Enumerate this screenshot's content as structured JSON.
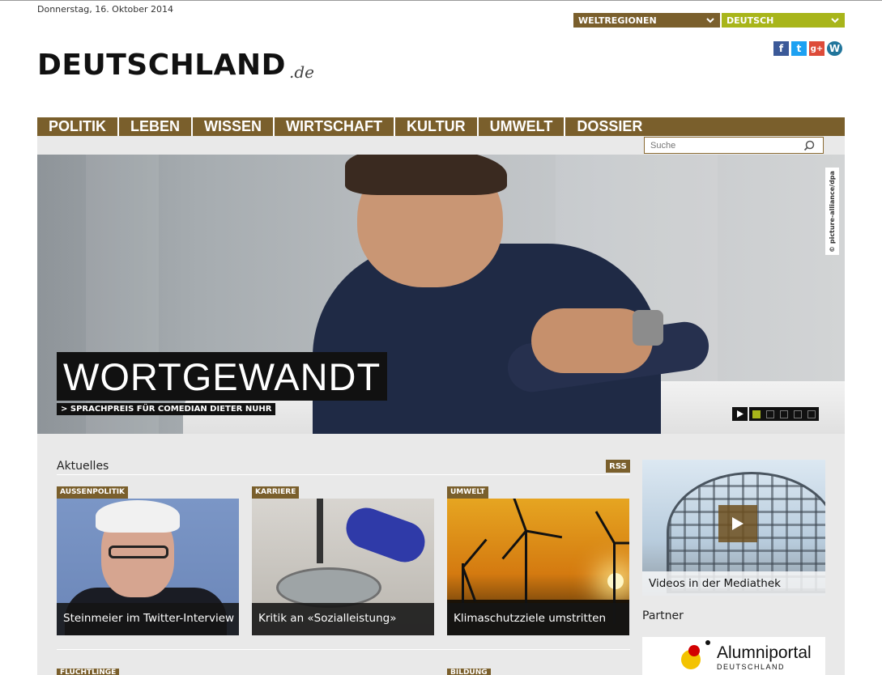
{
  "header": {
    "date": "Donnerstag, 16. Oktober 2014",
    "logo_main": "DEUTSCHLAND",
    "logo_tld": ".de",
    "region_dropdown": "WELTREGIONEN",
    "language_dropdown": "DEUTSCH",
    "social": [
      {
        "name": "facebook",
        "glyph": "f"
      },
      {
        "name": "twitter",
        "glyph": "t"
      },
      {
        "name": "google-plus",
        "glyph": "g+"
      },
      {
        "name": "wordpress",
        "glyph": "W"
      }
    ]
  },
  "nav": {
    "items": [
      "POLITIK",
      "LEBEN",
      "WISSEN",
      "WIRTSCHAFT",
      "KULTUR",
      "UMWELT",
      "DOSSIER"
    ]
  },
  "search": {
    "placeholder": "Suche"
  },
  "hero": {
    "headline": "WORTGEWANDT",
    "subheadline": "> SPRACHPREIS FÜR COMEDIAN DIETER NUHR",
    "credit": "© picture-alliance/dpa",
    "slides_total": 5,
    "active_slide": 1
  },
  "aktuelles": {
    "title": "Aktuelles",
    "rss": "RSS",
    "cards": [
      {
        "category": "AUSSENPOLITIK",
        "caption": "Steinmeier im Twitter-Interview"
      },
      {
        "category": "KARRIERE",
        "caption": "Kritik an «Sozialleistung»"
      },
      {
        "category": "UMWELT",
        "caption": "Klimaschutzziele umstritten"
      }
    ],
    "next_categories": [
      "FLÜCHTLINGE",
      "BILDUNG"
    ]
  },
  "sidebar": {
    "video_caption": "Videos in der Mediathek",
    "partner_title": "Partner",
    "alumni_name": "Alumniportal",
    "alumni_sub": "DEUTSCHLAND"
  },
  "colors": {
    "brand_brown": "#7a5f2c",
    "accent_green": "#a8b51a"
  }
}
